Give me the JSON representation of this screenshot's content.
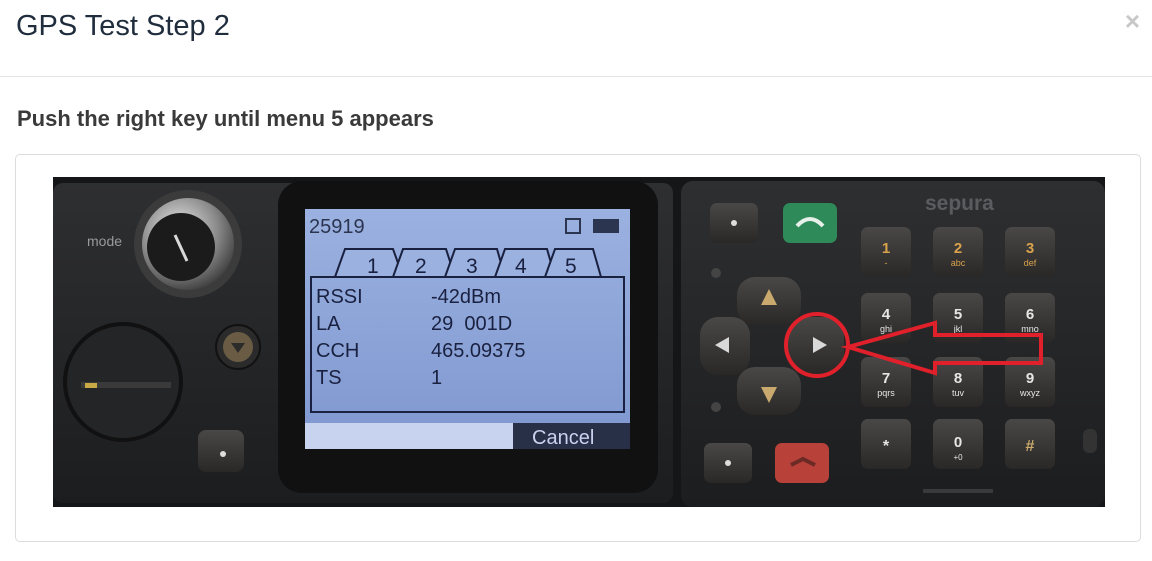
{
  "modal": {
    "title": "GPS Test Step 2",
    "close_symbol": "×",
    "instruction": "Push the right key until menu 5 appears"
  },
  "device": {
    "brand": "sepura",
    "mode_label": "mode",
    "screen": {
      "id_number": "25919",
      "tabs": [
        "1",
        "2",
        "3",
        "4",
        "5"
      ],
      "active_tab": "1",
      "rows": [
        {
          "label": "RSSI",
          "value": "-42dBm"
        },
        {
          "label": "LA",
          "value": "29  001D"
        },
        {
          "label": "CCH",
          "value": "465.09375"
        },
        {
          "label": "TS",
          "value": "1"
        }
      ],
      "softkey": "Cancel"
    },
    "keypad": [
      {
        "digit": "1",
        "letters": "-"
      },
      {
        "digit": "2",
        "letters": "abc"
      },
      {
        "digit": "3",
        "letters": "def"
      },
      {
        "digit": "4",
        "letters": "ghi"
      },
      {
        "digit": "5",
        "letters": "jkl"
      },
      {
        "digit": "6",
        "letters": "mno"
      },
      {
        "digit": "7",
        "letters": "pqrs"
      },
      {
        "digit": "8",
        "letters": "tuv"
      },
      {
        "digit": "9",
        "letters": "wxyz"
      },
      {
        "digit": "*",
        "letters": ""
      },
      {
        "digit": "0",
        "letters": "+0"
      },
      {
        "digit": "#",
        "letters": ""
      }
    ]
  },
  "colors": {
    "title": "#1f2d3d",
    "annotation": "#e0202a",
    "screen": "#8aa4d8",
    "call_green": "#2f8a5a",
    "end_red": "#b8413a"
  }
}
